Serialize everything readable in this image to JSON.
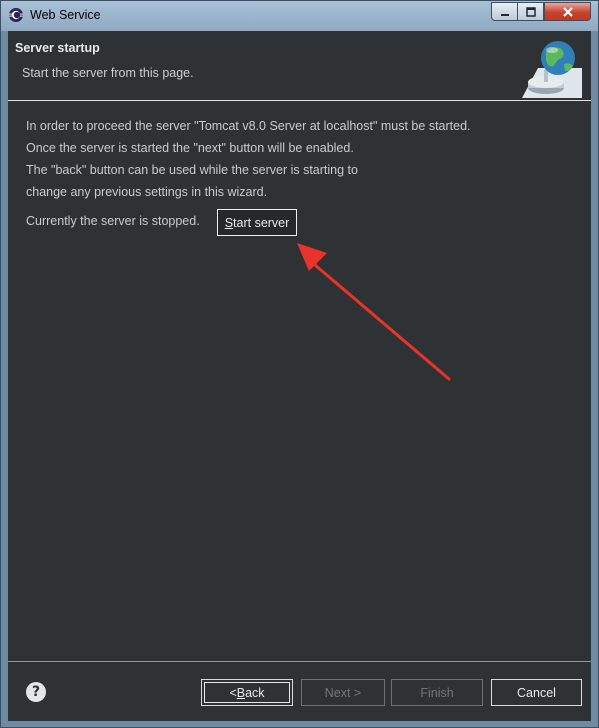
{
  "window": {
    "title": "Web Service"
  },
  "header": {
    "title": "Server startup",
    "description": "Start the server from this page."
  },
  "content": {
    "lines": [
      "In order to proceed the server \"Tomcat v8.0 Server at localhost\" must be started.",
      "Once the server is started the \"next\" button will be enabled.",
      "The \"back\" button can be used while the server is starting to",
      "change any previous settings in this wizard."
    ],
    "status": "Currently the server is stopped.",
    "start_button": {
      "mnemonic": "S",
      "rest": "tart server"
    }
  },
  "footer": {
    "back": {
      "prefix": "< ",
      "mnemonic": "B",
      "rest": "ack"
    },
    "next": "Next >",
    "finish": "Finish",
    "cancel": "Cancel"
  },
  "colors": {
    "annotation_arrow": "#e8322a",
    "background": "#2f3235",
    "text": "#c6ccd1"
  },
  "icons": {
    "window": "eclipse-icon",
    "header": "globe-server-icon",
    "help": "help-icon"
  }
}
